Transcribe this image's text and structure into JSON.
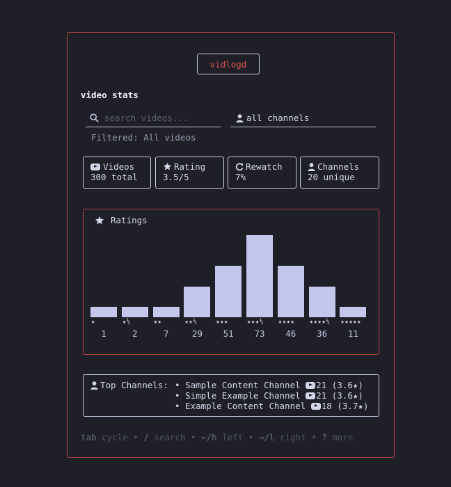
{
  "app": {
    "logo": "vidlogd",
    "title": "video stats"
  },
  "search": {
    "placeholder": "search videos...",
    "value": ""
  },
  "channel_filter": {
    "label": "all channels"
  },
  "filter_status": "Filtered: All videos",
  "cards": [
    {
      "label": "Videos",
      "value": "300 total",
      "icon": "youtube-icon"
    },
    {
      "label": "Rating",
      "value": "3.5/5",
      "icon": "star-icon"
    },
    {
      "label": "Rewatch",
      "value": "7%",
      "icon": "refresh-icon"
    },
    {
      "label": "Channels",
      "value": "20 unique",
      "icon": "user-icon"
    }
  ],
  "ratings_panel": {
    "title": "Ratings",
    "icon": "star-icon"
  },
  "chart_data": {
    "type": "bar",
    "categories": [
      "★",
      "★½",
      "★★",
      "★★½",
      "★★★",
      "★★★½",
      "★★★★",
      "★★★★½",
      "★★★★★"
    ],
    "values": [
      1,
      2,
      7,
      29,
      51,
      73,
      46,
      36,
      11
    ],
    "display_levels": [
      1,
      1,
      1,
      3,
      5,
      8,
      5,
      3,
      1
    ],
    "color": "#c3c7ec"
  },
  "top_channels": {
    "label": "Top Channels:",
    "items": [
      {
        "name": "Sample Content Channel",
        "count": "21",
        "rating": "(3.6★)"
      },
      {
        "name": "Simple Example Channel",
        "count": "21",
        "rating": "(3.6★)"
      },
      {
        "name": "Example Content Channel",
        "count": "18",
        "rating": "(3.7★)"
      }
    ]
  },
  "help_bar": [
    {
      "key": "tab",
      "action": "cycle"
    },
    {
      "key": "/",
      "action": "search"
    },
    {
      "key": "←/h",
      "action": "left"
    },
    {
      "key": "→/l",
      "action": "right"
    },
    {
      "key": "?",
      "action": "more"
    }
  ],
  "colors": {
    "background": "#1f1f27",
    "accent_red": "#b8433f",
    "logo_text": "#e0544c",
    "foreground": "#c2c6e0",
    "bar": "#c3c7ec"
  }
}
